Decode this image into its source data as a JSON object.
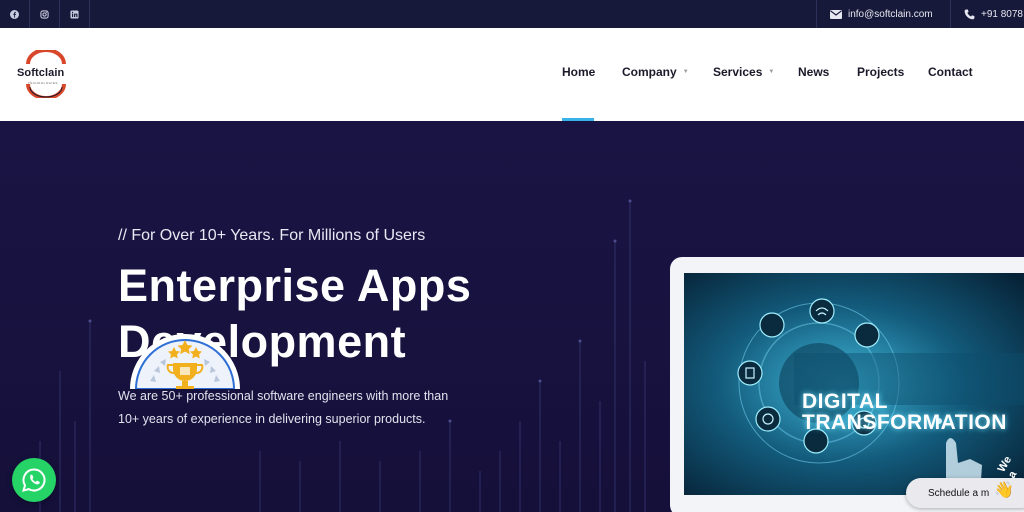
{
  "topbar": {
    "socials": [
      {
        "name": "facebook-icon"
      },
      {
        "name": "instagram-icon"
      },
      {
        "name": "linkedin-icon"
      }
    ],
    "email": "info@softclain.com",
    "phone": "+91 8078"
  },
  "logo": {
    "name": "Softclain",
    "sub": "TECHNOLOGIES"
  },
  "nav": {
    "items": [
      {
        "label": "Home",
        "dropdown": false,
        "active": true
      },
      {
        "label": "Company",
        "dropdown": true
      },
      {
        "label": "Services",
        "dropdown": true
      },
      {
        "label": "News",
        "dropdown": false
      },
      {
        "label": "Projects",
        "dropdown": false
      },
      {
        "label": "Contact",
        "dropdown": false
      }
    ]
  },
  "hero": {
    "tagline": "// For Over 10+ Years. For Millions of Users",
    "headline_line1": "Enterprise Apps",
    "headline_line2": "Development",
    "description_line1": "We are 50+ professional software engineers with more than",
    "description_line2": "10+ years of experience in delivering superior products.",
    "laptop_text_line1": "DIGITAL",
    "laptop_text_line2": "TRANSFORMATION"
  },
  "widgets": {
    "schedule_label": "Schedule a m",
    "we_are_label": "We a"
  },
  "colors": {
    "topbar_bg": "#17193a",
    "hero_bg": "#17133d",
    "accent": "#38b3e8",
    "whatsapp": "#25d366",
    "logo_red": "#d9472b"
  }
}
